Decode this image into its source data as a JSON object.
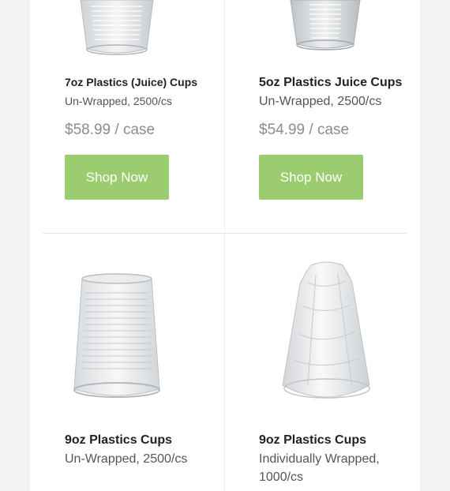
{
  "products": [
    {
      "title": "7oz Plastics (Juice) Cups",
      "subtitle": "Un-Wrapped, 2500/cs",
      "price": "$58.99 / case",
      "button": "Shop Now"
    },
    {
      "title": "5oz Plastics Juice Cups",
      "subtitle": "Un-Wrapped, 2500/cs",
      "price": "$54.99 / case",
      "button": "Shop Now"
    },
    {
      "title": "9oz Plastics Cups",
      "subtitle": "Un-Wrapped, 2500/cs"
    },
    {
      "title": "9oz Plastics Cups",
      "subtitle_line1": "Individually Wrapped,",
      "subtitle_line2": "1000/cs"
    }
  ],
  "colors": {
    "button_green": "#9ccc70",
    "price_gray": "#8c8c8c"
  }
}
